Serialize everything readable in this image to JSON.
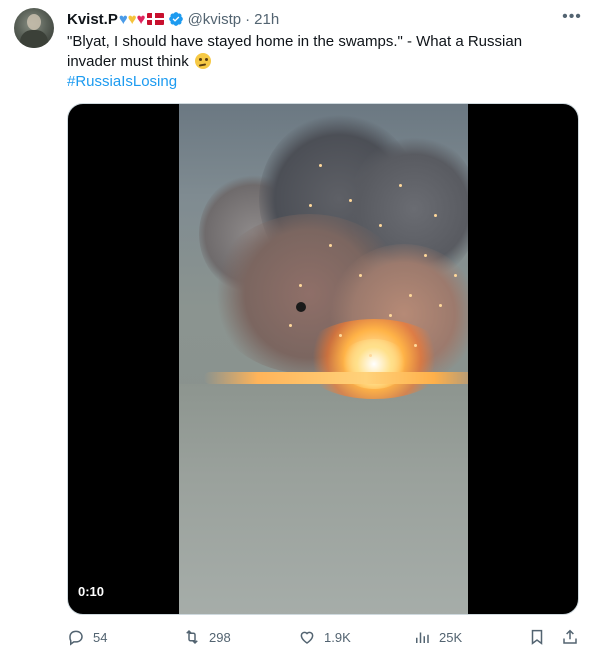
{
  "author": {
    "name": "Kvist.P",
    "name_emojis": [
      "blue-heart",
      "yellow-heart",
      "red-heart",
      "denmark-flag"
    ],
    "handle": "@kvistp",
    "time": "21h"
  },
  "tweet": {
    "text": "\"Blyat, I should have stayed home in the swamps.\" - What a Russian invader must think",
    "emoji": "thinking-face",
    "hashtag": "#RussiaIsLosing"
  },
  "media": {
    "duration": "0:10"
  },
  "actions": {
    "replies": "54",
    "retweets": "298",
    "likes": "1.9K",
    "views": "25K"
  },
  "colors": {
    "accent": "#1d9bf0",
    "muted": "#536471",
    "text": "#0f1419"
  }
}
